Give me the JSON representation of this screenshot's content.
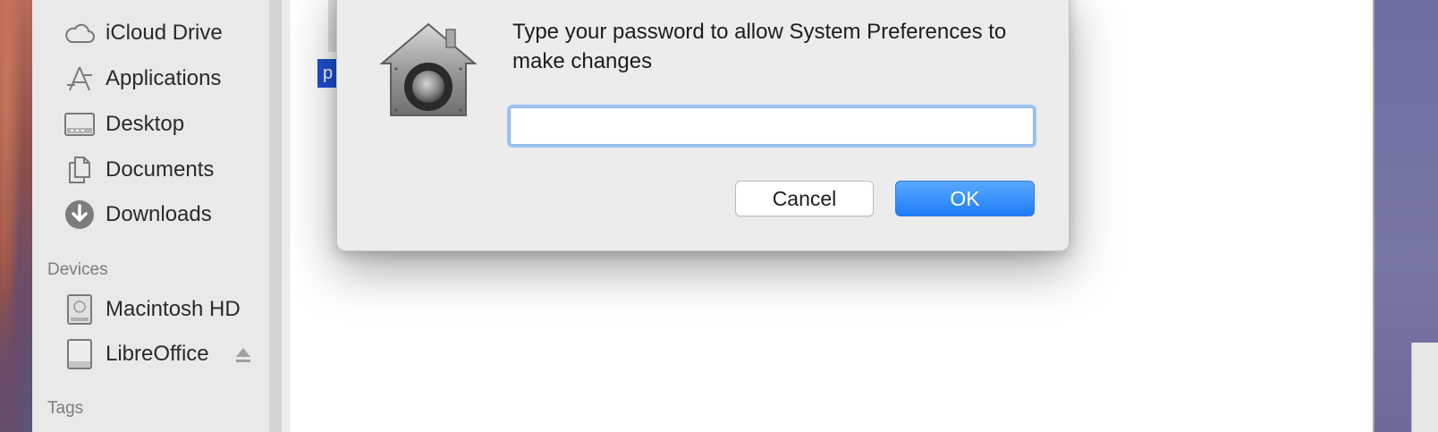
{
  "sidebar": {
    "items": [
      {
        "label": "iCloud Drive",
        "icon": "cloud-icon"
      },
      {
        "label": "Applications",
        "icon": "applications-icon"
      },
      {
        "label": "Desktop",
        "icon": "desktop-icon"
      },
      {
        "label": "Documents",
        "icon": "documents-icon"
      },
      {
        "label": "Downloads",
        "icon": "downloads-icon"
      }
    ],
    "devices_heading": "Devices",
    "devices": [
      {
        "label": "Macintosh HD",
        "icon": "hard-drive-icon"
      },
      {
        "label": "LibreOffice",
        "icon": "disk-image-icon",
        "ejectable": true
      }
    ],
    "tags_heading": "Tags"
  },
  "content": {
    "partial_selected_label": "p"
  },
  "dialog": {
    "icon": "lock-house-icon",
    "message": "Type your password to allow System Preferences to make changes",
    "password_value": "",
    "cancel_label": "Cancel",
    "ok_label": "OK"
  },
  "colors": {
    "accent": "#1e7cf6",
    "focus_ring": "#9cc3f4",
    "sidebar_bg": "#e9e9e9",
    "dialog_bg": "#ececec"
  }
}
